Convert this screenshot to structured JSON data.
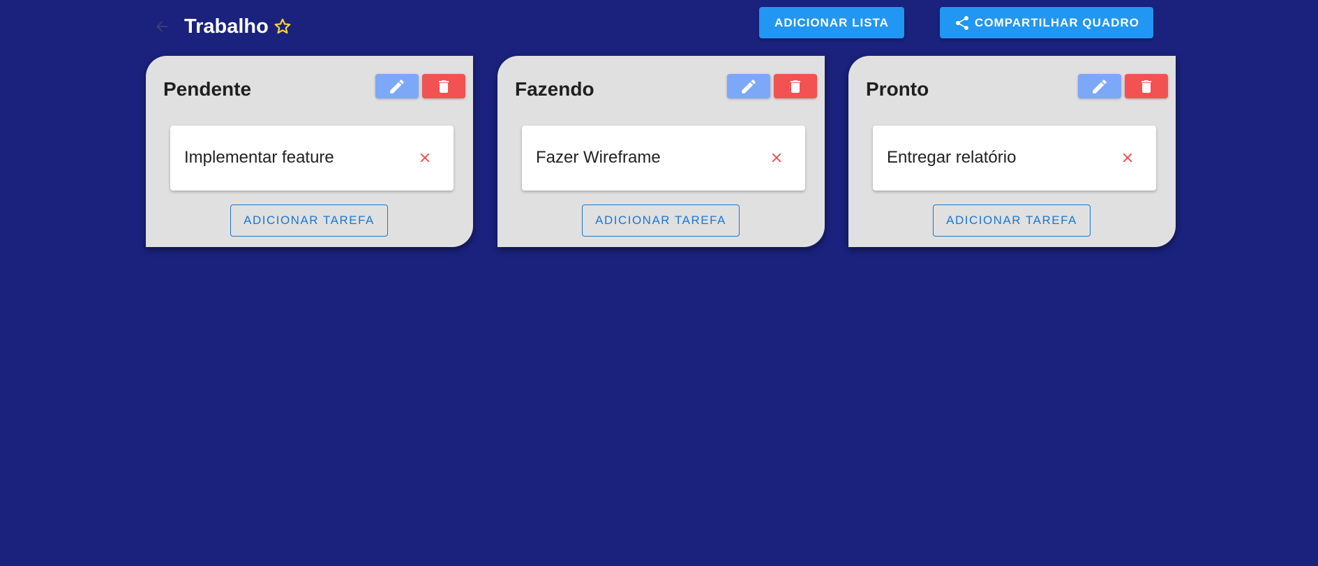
{
  "header": {
    "back_icon": "arrow-left-icon",
    "title": "Trabalho",
    "star_icon": "star-outline-icon",
    "star_color": "#fdd835",
    "add_list_label": "ADICIONAR LISTA",
    "share_icon": "share-icon",
    "share_label": "COMPARTILHAR QUADRO"
  },
  "colors": {
    "background": "#1a227d",
    "primary_button": "#2196f3",
    "edit_button": "#7da8f7",
    "delete_button": "#f25252",
    "list_background": "#e0e0e0"
  },
  "lists": [
    {
      "title": "Pendente",
      "edit_icon": "pencil-icon",
      "delete_icon": "trash-icon",
      "tasks": [
        {
          "text": "Implementar feature",
          "remove_icon": "close-icon"
        }
      ],
      "add_task_label": "ADICIONAR TAREFA"
    },
    {
      "title": "Fazendo",
      "edit_icon": "pencil-icon",
      "delete_icon": "trash-icon",
      "tasks": [
        {
          "text": "Fazer Wireframe",
          "remove_icon": "close-icon"
        }
      ],
      "add_task_label": "ADICIONAR TAREFA"
    },
    {
      "title": "Pronto",
      "edit_icon": "pencil-icon",
      "delete_icon": "trash-icon",
      "tasks": [
        {
          "text": "Entregar relatório",
          "remove_icon": "close-icon"
        }
      ],
      "add_task_label": "ADICIONAR TAREFA"
    }
  ]
}
